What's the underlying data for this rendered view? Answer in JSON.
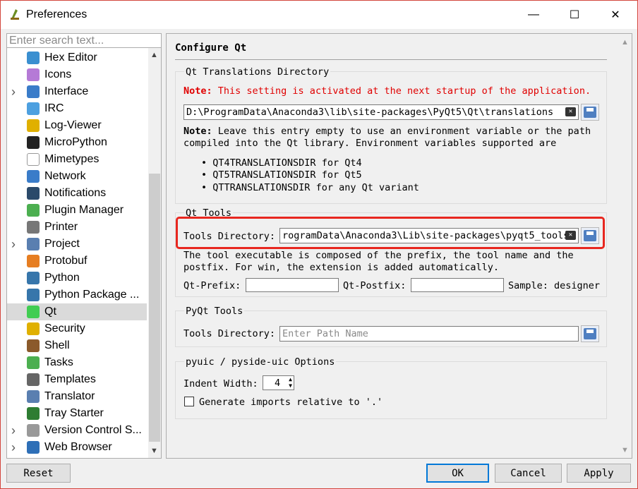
{
  "window": {
    "title": "Preferences",
    "minimize": "—",
    "maximize": "☐",
    "close": "✕"
  },
  "search": {
    "placeholder": "Enter search text..."
  },
  "tree": {
    "items": [
      {
        "label": "Hex Editor",
        "icon": "hex-editor-icon",
        "color": "#3a8fd0",
        "expandable": false
      },
      {
        "label": "Icons",
        "icon": "icons-icon",
        "color": "#b57ad6",
        "expandable": false
      },
      {
        "label": "Interface",
        "icon": "interface-icon",
        "color": "#3a7cc9",
        "expandable": true
      },
      {
        "label": "IRC",
        "icon": "irc-icon",
        "color": "#4da0e0",
        "expandable": false
      },
      {
        "label": "Log-Viewer",
        "icon": "log-viewer-icon",
        "color": "#e0b000",
        "expandable": false
      },
      {
        "label": "MicroPython",
        "icon": "micropython-icon",
        "color": "#222222",
        "expandable": false
      },
      {
        "label": "Mimetypes",
        "icon": "mimetypes-icon",
        "color": "#ffffff",
        "expandable": false
      },
      {
        "label": "Network",
        "icon": "network-icon",
        "color": "#3a7cc9",
        "expandable": false
      },
      {
        "label": "Notifications",
        "icon": "notifications-icon",
        "color": "#2b4a6a",
        "expandable": false
      },
      {
        "label": "Plugin Manager",
        "icon": "plugin-manager-icon",
        "color": "#4caf50",
        "expandable": false
      },
      {
        "label": "Printer",
        "icon": "printer-icon",
        "color": "#777777",
        "expandable": false
      },
      {
        "label": "Project",
        "icon": "project-icon",
        "color": "#5a7fb0",
        "expandable": true
      },
      {
        "label": "Protobuf",
        "icon": "protobuf-icon",
        "color": "#e67e22",
        "expandable": false
      },
      {
        "label": "Python",
        "icon": "python-icon",
        "color": "#3776ab",
        "expandable": false
      },
      {
        "label": "Python Package ...",
        "icon": "python-package-icon",
        "color": "#3776ab",
        "expandable": false
      },
      {
        "label": "Qt",
        "icon": "qt-icon",
        "color": "#41cd52",
        "expandable": false,
        "selected": true
      },
      {
        "label": "Security",
        "icon": "lock-icon",
        "color": "#e0b000",
        "expandable": false
      },
      {
        "label": "Shell",
        "icon": "shell-icon",
        "color": "#8b5a2b",
        "expandable": false
      },
      {
        "label": "Tasks",
        "icon": "tasks-icon",
        "color": "#4caf50",
        "expandable": false
      },
      {
        "label": "Templates",
        "icon": "templates-icon",
        "color": "#666666",
        "expandable": false
      },
      {
        "label": "Translator",
        "icon": "translator-icon",
        "color": "#5a7fb0",
        "expandable": false
      },
      {
        "label": "Tray Starter",
        "icon": "tray-starter-icon",
        "color": "#2e7d32",
        "expandable": false
      },
      {
        "label": "Version Control S...",
        "icon": "version-control-icon",
        "color": "#999999",
        "expandable": true
      },
      {
        "label": "Web Browser",
        "icon": "web-browser-icon",
        "color": "#2e6fb7",
        "expandable": true
      }
    ]
  },
  "page": {
    "heading": "Configure Qt",
    "translations": {
      "title": "Qt Translations Directory",
      "note_label": "Note:",
      "note_text": " This setting is activated at the next startup of the application.",
      "path": "D:\\ProgramData\\Anaconda3\\lib\\site-packages\\PyQt5\\Qt\\translations",
      "info_label": "Note:",
      "info_line1": " Leave this entry empty to use an environment variable or the path",
      "info_line2": "compiled into the Qt library. Environment variables supported are",
      "bullets": [
        "QT4TRANSLATIONSDIR for Qt4",
        "QT5TRANSLATIONSDIR for Qt5",
        "QTTRANSLATIONSDIR for any Qt variant"
      ]
    },
    "qt_tools": {
      "title": "Qt Tools",
      "dir_label": "Tools Directory:",
      "dir_value": "rogramData\\Anaconda3\\Lib\\site-packages\\pyqt5_tools",
      "desc1": "The tool executable is composed of the prefix, the tool name and the",
      "desc2": "postfix. For win, the extension is added automatically.",
      "prefix_label": "Qt-Prefix:",
      "postfix_label": "Qt-Postfix:",
      "sample": "Sample: designer"
    },
    "pyqt_tools": {
      "title": "PyQt Tools",
      "dir_label": "Tools Directory:",
      "placeholder": "Enter Path Name"
    },
    "pyuic": {
      "title": "pyuic / pyside-uic Options",
      "indent_label": "Indent Width:",
      "indent_value": "4",
      "relative_label": "Generate imports relative to '.'"
    }
  },
  "buttons": {
    "reset": "Reset",
    "ok": "OK",
    "cancel": "Cancel",
    "apply": "Apply"
  }
}
